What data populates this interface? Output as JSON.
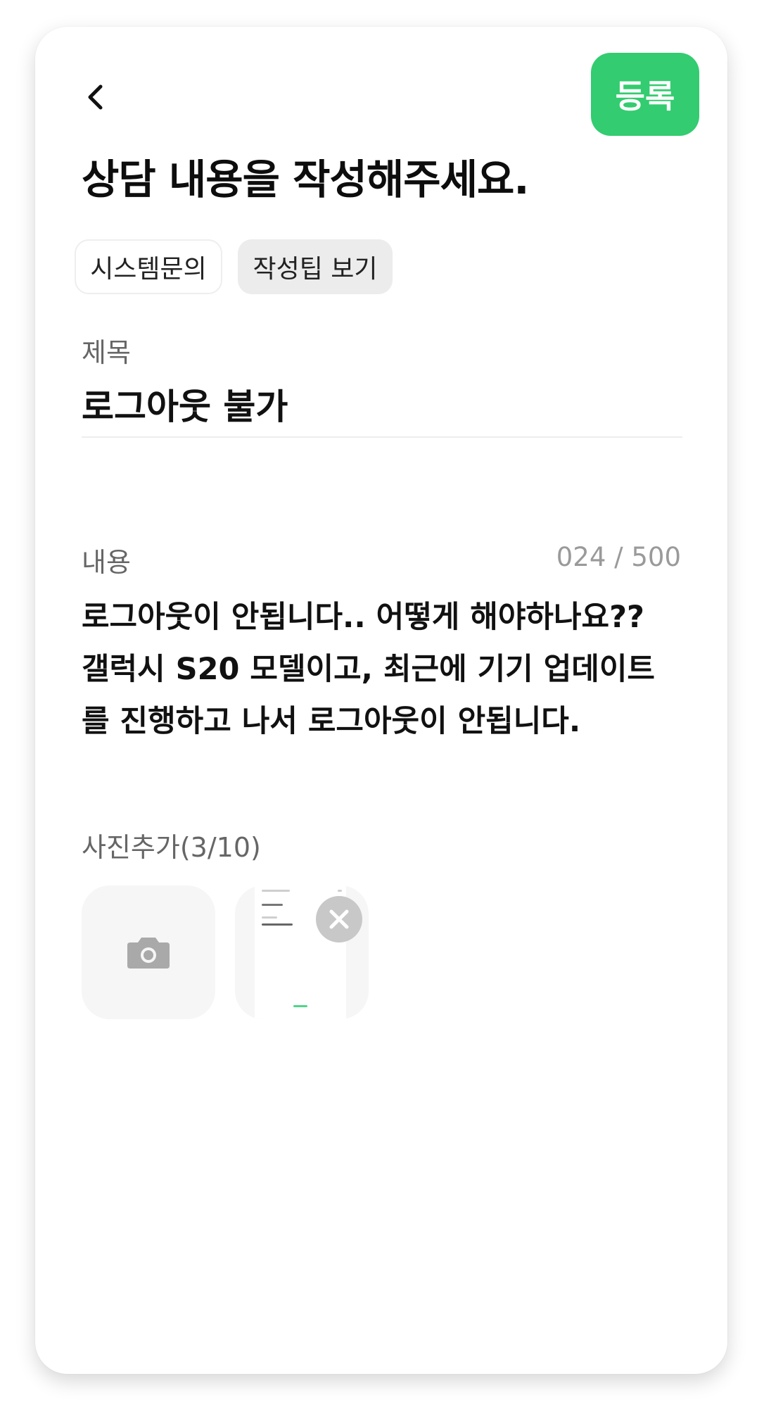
{
  "header": {
    "back_icon": "chevron-left-icon",
    "register_label": "등록",
    "register_color": "#33cc70"
  },
  "page_title": "상담 내용을 작성해주세요.",
  "chips": {
    "category": "시스템문의",
    "tips": "작성팁 보기"
  },
  "title_field": {
    "label": "제목",
    "value": "로그아웃 불가"
  },
  "content_field": {
    "label": "내용",
    "char_count": "024  / 500",
    "lines": [
      "로그아웃이 안됩니다.. 어떻게 해야하나요??",
      "갤럭시 S20 모델이고, 최근에 기기 업데이트",
      "를 진행하고 나서 로그아웃이 안됩니다."
    ]
  },
  "photos": {
    "label": "사진추가(3/10)",
    "add_icon": "camera-icon",
    "remove_icon": "close-icon"
  }
}
